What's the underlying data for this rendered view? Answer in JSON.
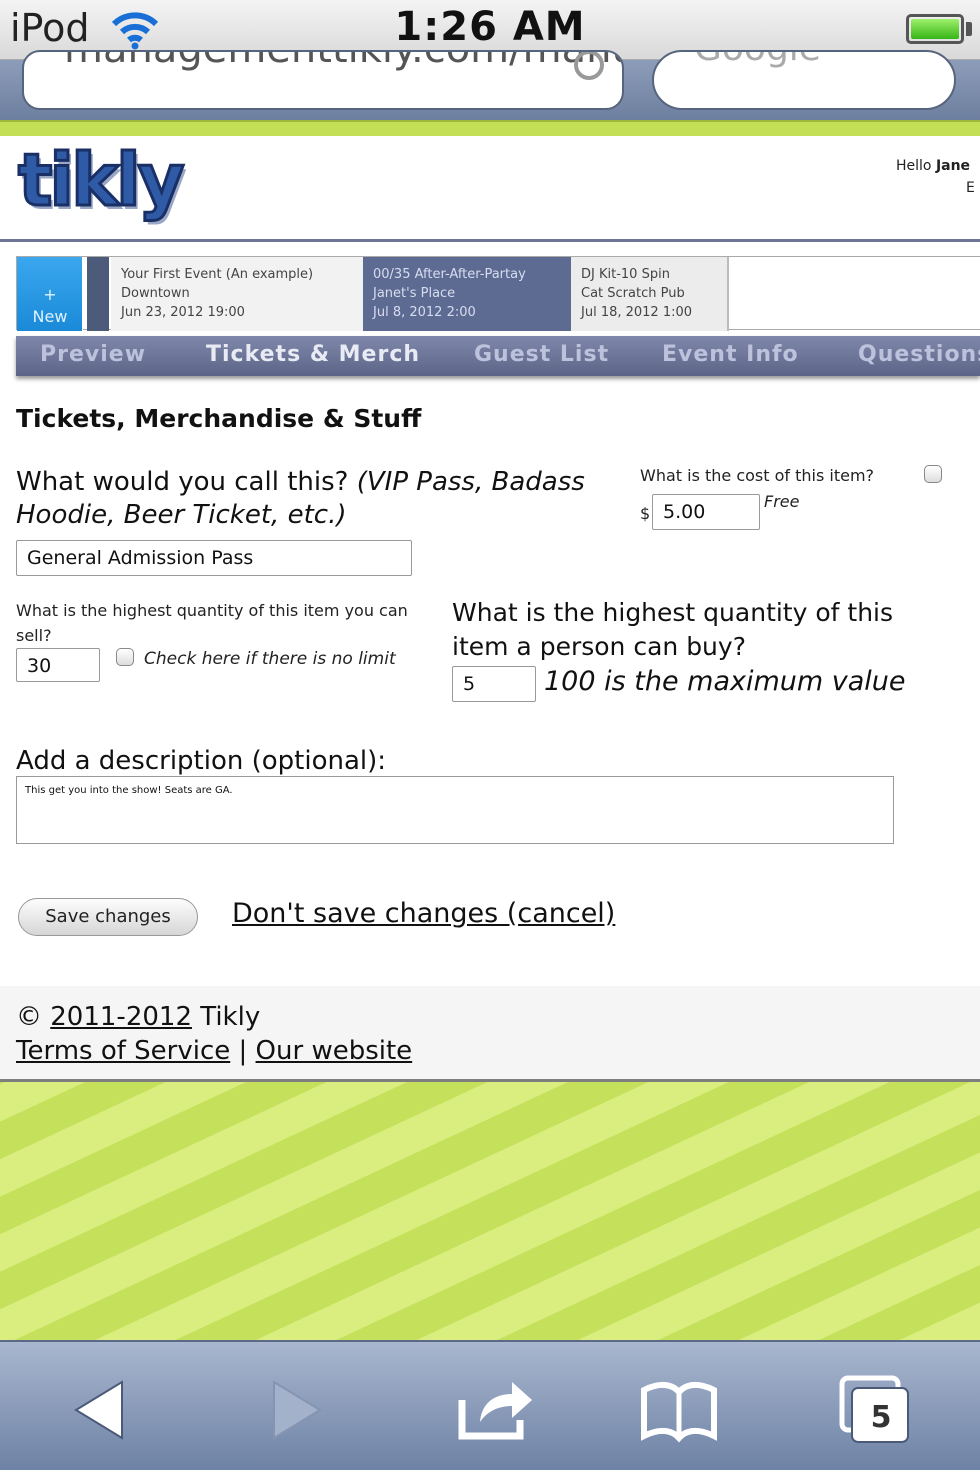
{
  "status_bar": {
    "device": "iPod",
    "time": "1:26 AM",
    "battery_level": 1.0
  },
  "browser": {
    "url_partial": "managementtikly.com/manum",
    "search_placeholder": "Google"
  },
  "header": {
    "logo_text": "tikly",
    "hello_label": "Hello ",
    "user_name": "Jane",
    "edit_partial": "E"
  },
  "events": {
    "new_plus": "+",
    "new_label": "New",
    "items": [
      {
        "title": "Your First Event (An example)",
        "venue": "Downtown",
        "date": "Jun 23, 2012 19:00"
      },
      {
        "title": "00/35 After-After-Partay",
        "venue": "Janet's Place",
        "date": "Jul 8, 2012 2:00"
      },
      {
        "title": "DJ Kit-10 Spin",
        "venue": "Cat Scratch Pub",
        "date": "Jul 18, 2012 1:00"
      }
    ]
  },
  "nav": {
    "tabs": [
      "Preview",
      "Tickets & Merch",
      "Guest List",
      "Event Info",
      "Questions"
    ]
  },
  "form": {
    "title": "Tickets, Merchandise & Stuff",
    "name_question": "What would you call this? ",
    "name_examples": "(VIP Pass, Badass Hoodie, Beer Ticket, etc.)",
    "name_value": "General Admission Pass",
    "cost_question": "What is the cost of this item?",
    "currency": "$",
    "cost_value": "5.00",
    "free_label": "Free",
    "sell_question": "What is the highest quantity of this item you can sell?",
    "sell_value": "30",
    "nolimit_label": "Check here if there is no limit",
    "buy_question": "What is the highest quantity of this item a person can buy?",
    "buy_value": "5",
    "max_label": "100 is the maximum value",
    "desc_question": "Add a description (optional):",
    "desc_value": "This get you into the show! Seats are GA.",
    "save_label": "Save changes",
    "cancel_label": "Don't save changes (cancel)"
  },
  "footer": {
    "copyright_symbol": "©",
    "years": "2011-2012",
    "brand": "Tikly",
    "terms": "Terms of Service",
    "separator": "|",
    "website": "Our website"
  },
  "toolbar": {
    "tabs_count": "5"
  },
  "colors": {
    "nav_bg": "#6e7799",
    "selected_event": "#5d6b92",
    "new_button": "#2a97e4",
    "page_green": "#c5e05a",
    "toolbar": "#8d9db9"
  }
}
